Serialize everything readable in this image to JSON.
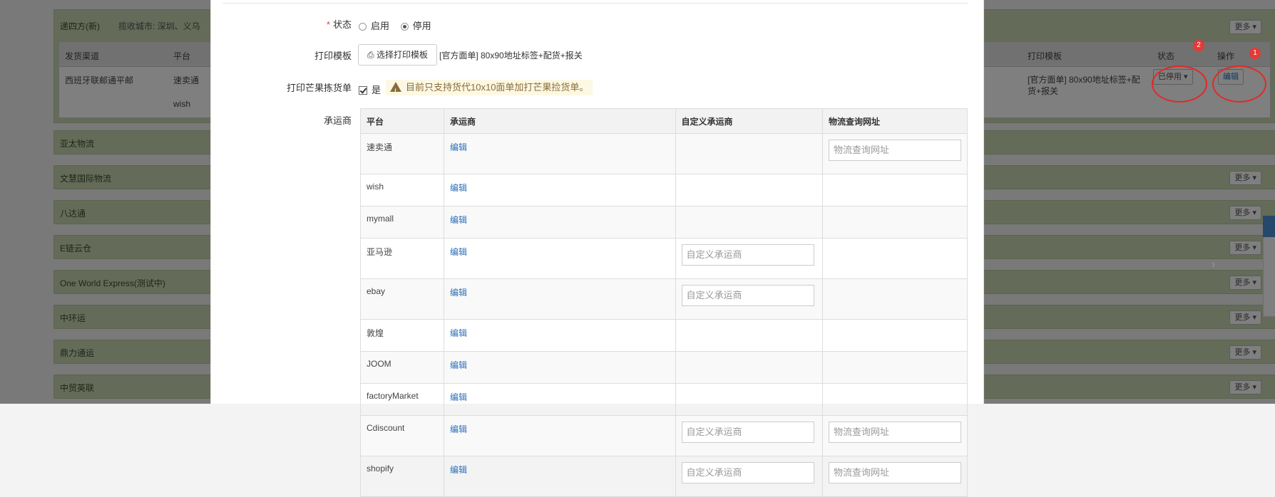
{
  "background": {
    "first_panel": {
      "title": "递四方(新)",
      "cities": "揽收城市: 深圳、义乌",
      "more_label": "更多",
      "headers": [
        "发货渠道",
        "平台",
        "打印模板",
        "状态",
        "操作"
      ],
      "row": {
        "channel": "西班牙联邮通平邮",
        "platforms": [
          "速卖通",
          "wish"
        ],
        "template": "[官方面单] 80x90地址标签+配货+报关",
        "status_button": "已停用",
        "edit_button": "编辑"
      },
      "badges": [
        "2",
        "1"
      ]
    },
    "panels": [
      {
        "title": "亚太物流",
        "more_label": ""
      },
      {
        "title": "文慧国际物流",
        "more_label": "更多"
      },
      {
        "title": "八达通",
        "more_label": "更多"
      },
      {
        "title": "E链云仓",
        "more_label": "更多"
      },
      {
        "title": "One World Express(测试中)",
        "more_label": "更多"
      },
      {
        "title": "中环运",
        "more_label": "更多"
      },
      {
        "title": "鼎力通运",
        "more_label": "更多"
      },
      {
        "title": "中贸英联",
        "more_label": "更多"
      }
    ]
  },
  "modal": {
    "status": {
      "label": "状态",
      "required_mark": "*",
      "options": [
        "启用",
        "停用"
      ],
      "selected": "停用"
    },
    "print_template": {
      "label": "打印模板",
      "button": "选择打印模板",
      "value": "[官方面单] 80x90地址标签+配货+报关"
    },
    "mango_pick": {
      "label": "打印芒果拣货单",
      "checkbox_label": "是",
      "checked": true,
      "warning": "目前只支持货代10x10面单加打芒果捡货单。"
    },
    "carrier": {
      "label": "承运商",
      "headers": [
        "平台",
        "承运商",
        "自定义承运商",
        "物流查询网址"
      ],
      "edit_label": "编辑",
      "custom_placeholder": "自定义承运商",
      "url_placeholder": "物流查询网址",
      "rows": [
        {
          "platform": "速卖通",
          "custom": false,
          "url": true
        },
        {
          "platform": "wish",
          "custom": false,
          "url": false
        },
        {
          "platform": "mymall",
          "custom": false,
          "url": false
        },
        {
          "platform": "亚马逊",
          "custom": true,
          "url": false
        },
        {
          "platform": "ebay",
          "custom": true,
          "url": false
        },
        {
          "platform": "敦煌",
          "custom": false,
          "url": false
        },
        {
          "platform": "JOOM",
          "custom": false,
          "url": false
        },
        {
          "platform": "factoryMarket",
          "custom": false,
          "url": false
        },
        {
          "platform": "Cdiscount",
          "custom": true,
          "url": true
        },
        {
          "platform": "shopify",
          "custom": true,
          "url": true
        }
      ]
    }
  },
  "colors": {
    "panel_green": "#c9d7b3",
    "link_blue": "#2a6fb8",
    "warning_bg": "#fcf8e3",
    "warning_text": "#8a6d3b",
    "highlight_red": "#e02a2a"
  }
}
